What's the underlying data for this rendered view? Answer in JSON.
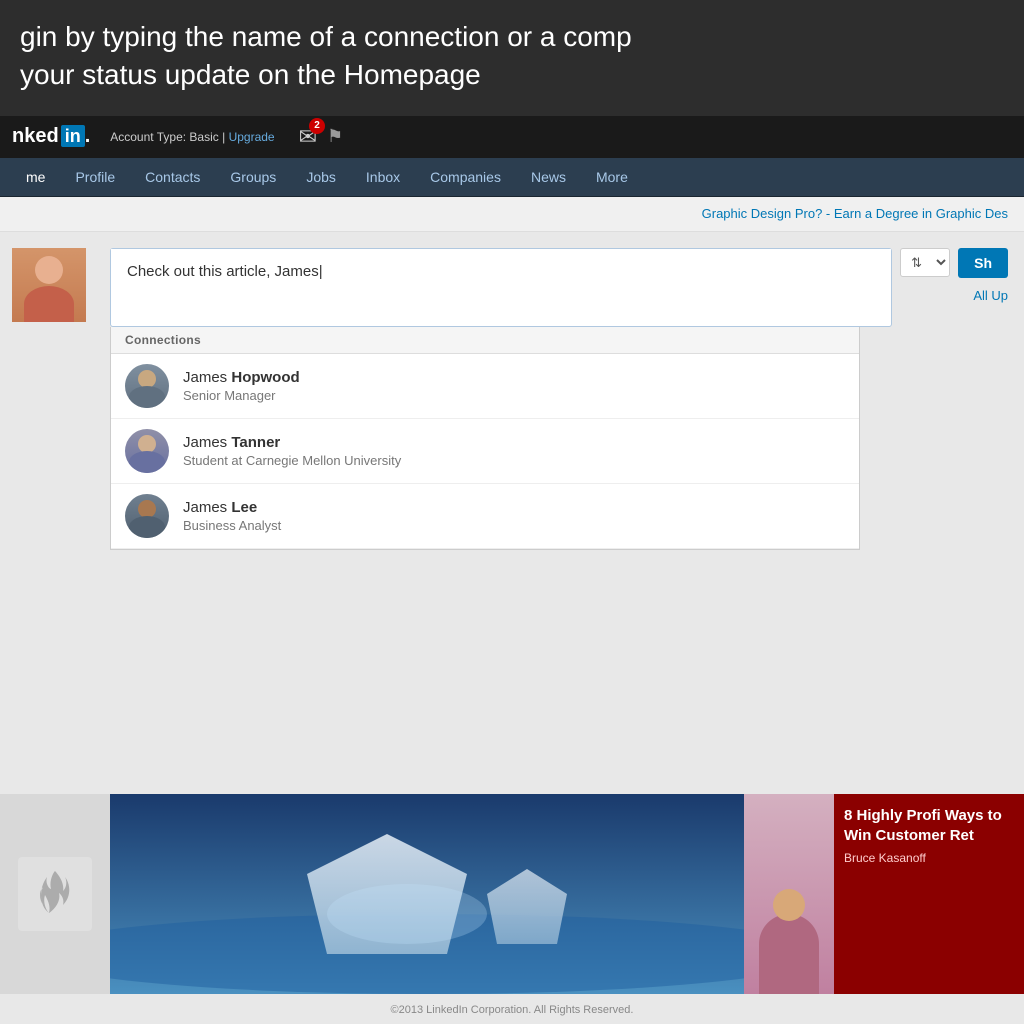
{
  "top_banner": {
    "line1": "gin by typing the name of a connection or a comp",
    "line2": "your status update on the Homepage"
  },
  "linkedin_nav": {
    "brand_text": "nked",
    "in_label": "in",
    "account_label": "Account Type: Basic |",
    "upgrade_label": "Upgrade",
    "notification_count": "2",
    "flag_label": "Flag"
  },
  "nav_menu": {
    "items": [
      {
        "label": "me",
        "active": true
      },
      {
        "label": "Profile"
      },
      {
        "label": "Contacts"
      },
      {
        "label": "Groups"
      },
      {
        "label": "Jobs"
      },
      {
        "label": "Inbox"
      },
      {
        "label": "Companies"
      },
      {
        "label": "News"
      },
      {
        "label": "More"
      }
    ]
  },
  "ad_banner": {
    "text": "Graphic Design Pro? - Earn a Degree in Graphic Des"
  },
  "status_update": {
    "input_value": "Check out this article, James|",
    "connections_label": "Connections"
  },
  "connections": [
    {
      "name_first": "James",
      "name_last": "Hopwood",
      "title": "Senior Manager",
      "avatar_class": "avatar-hopwood"
    },
    {
      "name_first": "James",
      "name_last": "Tanner",
      "title": "Student at Carnegie Mellon University",
      "avatar_class": "avatar-tanner"
    },
    {
      "name_first": "James",
      "name_last": "Lee",
      "title": "Business Analyst",
      "avatar_class": "avatar-lee"
    }
  ],
  "share_controls": {
    "share_button_label": "Sh",
    "all_updates_label": "All Up"
  },
  "article": {
    "headline": "8 Highly Profi Ways to Win Customer Ret",
    "author": "Bruce Kasanoff"
  },
  "footer": {
    "copyright": "©2013 LinkedIn Corporation. All Rights Reserved."
  }
}
